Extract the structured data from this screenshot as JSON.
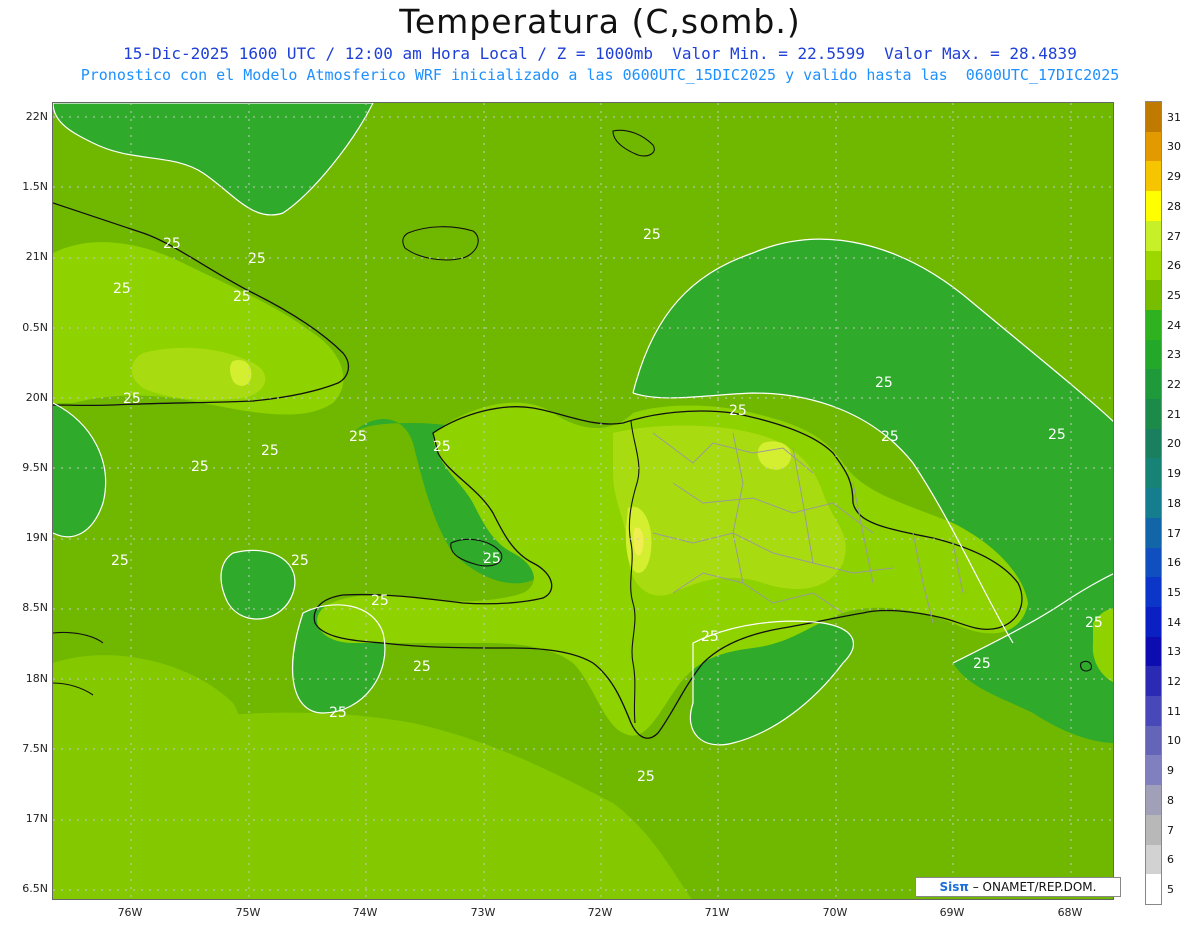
{
  "header": {
    "title": "Temperatura (C,somb.)",
    "subtitle_1": "15-Dic-2025 1600 UTC / 12:00 am Hora Local / Z = 1000mb  Valor Min. = 22.5599  Valor Max. = 28.4839",
    "subtitle_2": "Pronostico con el Modelo Atmosferico WRF inicializado a las 0600UTC_15DIC2025 y valido hasta las  0600UTC_17DIC2025"
  },
  "axes": {
    "lat_labels": [
      "22N",
      "1.5N",
      "21N",
      "0.5N",
      "20N",
      "9.5N",
      "19N",
      "8.5N",
      "18N",
      "7.5N",
      "17N",
      "6.5N"
    ],
    "lon_labels": [
      "76W",
      "75W",
      "74W",
      "73W",
      "72W",
      "71W",
      "70W",
      "69W",
      "68W"
    ]
  },
  "colorbar": {
    "labels": [
      "31",
      "30",
      "29",
      "28",
      "27",
      "26",
      "25",
      "24",
      "23",
      "22",
      "21",
      "20",
      "19",
      "18",
      "17",
      "16",
      "15",
      "14",
      "13",
      "12",
      "11",
      "10",
      "9",
      "8",
      "7",
      "6",
      "5"
    ],
    "colors": [
      "#c07a00",
      "#e39a00",
      "#f7c400",
      "#ffff00",
      "#c8f028",
      "#9cd800",
      "#78be00",
      "#2fb21f",
      "#23a82a",
      "#1e9a3a",
      "#1c8a48",
      "#1a7f5f",
      "#178276",
      "#147d8e",
      "#1266a8",
      "#0f4fc0",
      "#0b36c8",
      "#0a20c2",
      "#0c0cb0",
      "#2a2ab4",
      "#4848b8",
      "#6464b8",
      "#8080c0",
      "#a0a0b8",
      "#b8b8b8",
      "#d2d2d2",
      "#ffffff"
    ]
  },
  "map": {
    "contour_value_label": "25",
    "colors": {
      "ocean_base": "#70b800",
      "sea_band": "#84c800",
      "warm_belt": "#8ed200",
      "inner_land": "#a8dc10",
      "hot_spot": "#d4ef30",
      "peak": "#f0ee50",
      "cool_zone": "#2faa2a",
      "border": "#111111",
      "province": "#9a9a9a",
      "contour": "#ffffff"
    }
  },
  "credit": {
    "brand": "Sisπ",
    "text": " – ONAMET/REP.DOM."
  }
}
